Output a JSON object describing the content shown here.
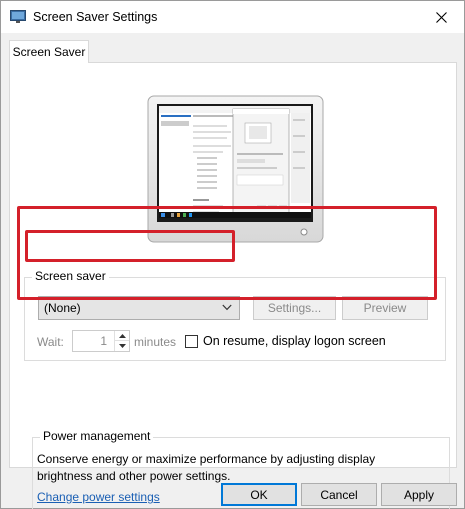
{
  "window": {
    "title": "Screen Saver Settings",
    "icon": "monitor-icon",
    "close_icon": "close-icon"
  },
  "tabs": [
    {
      "label": "Screen Saver",
      "selected": true
    }
  ],
  "screen_saver": {
    "group_label": "Screen saver",
    "selected": "(None)",
    "settings_label": "Settings...",
    "preview_label": "Preview",
    "wait_label": "Wait:",
    "wait_value": "1",
    "minutes_label": "minutes",
    "resume_label": "On resume, display logon screen",
    "resume_checked": false
  },
  "power": {
    "group_label": "Power management",
    "description": "Conserve energy or maximize performance by adjusting display brightness and other power settings.",
    "link": "Change power settings"
  },
  "footer": {
    "ok": "OK",
    "cancel": "Cancel",
    "apply": "Apply"
  },
  "colors": {
    "highlight": "#d4202a",
    "link": "#1a5fb4",
    "accent": "#0078d7"
  }
}
